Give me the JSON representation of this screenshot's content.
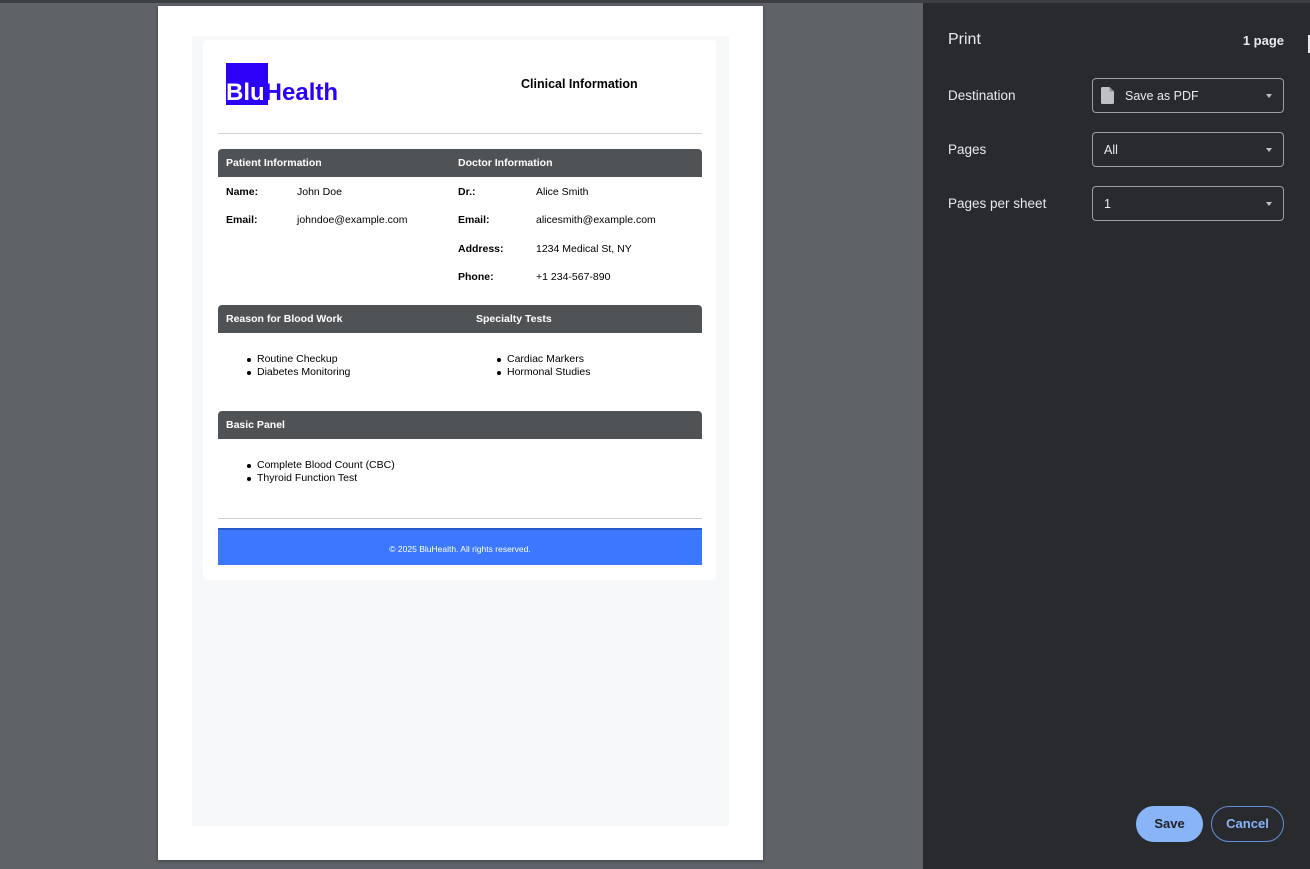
{
  "document": {
    "logo_text_white": "Blu",
    "logo_text_blue": "Health",
    "title": "Clinical Information",
    "patient": {
      "header": "Patient Information",
      "name_label": "Name:",
      "name_value": "John Doe",
      "email_label": "Email:",
      "email_value": "johndoe@example.com"
    },
    "doctor": {
      "header": "Doctor Information",
      "dr_label": "Dr.:",
      "dr_value": "Alice Smith",
      "email_label": "Email:",
      "email_value": "alicesmith@example.com",
      "address_label": "Address:",
      "address_value": "1234 Medical St, NY",
      "phone_label": "Phone:",
      "phone_value": "+1 234-567-890"
    },
    "reason": {
      "header": "Reason for Blood Work",
      "items": [
        "Routine Checkup",
        "Diabetes Monitoring"
      ]
    },
    "specialty": {
      "header": "Specialty Tests",
      "items": [
        "Cardiac Markers",
        "Hormonal Studies"
      ]
    },
    "basic_panel": {
      "header": "Basic Panel",
      "items": [
        "Complete Blood Count (CBC)",
        "Thyroid Function Test"
      ]
    },
    "footer": "© 2025 BluHealth. All rights reserved.",
    "colors": {
      "brand": "#2d00f7",
      "section_bar": "#505356",
      "footer_bar": "#3b78ff"
    }
  },
  "print_panel": {
    "title": "Print",
    "page_count": "1 page",
    "destination_label": "Destination",
    "destination_value": "Save as PDF",
    "destination_icon": "file-icon",
    "pages_label": "Pages",
    "pages_value": "All",
    "pages_per_sheet_label": "Pages per sheet",
    "pages_per_sheet_value": "1",
    "save_label": "Save",
    "cancel_label": "Cancel",
    "colors": {
      "background": "#292a2d",
      "accent": "#8ab4f8"
    }
  }
}
